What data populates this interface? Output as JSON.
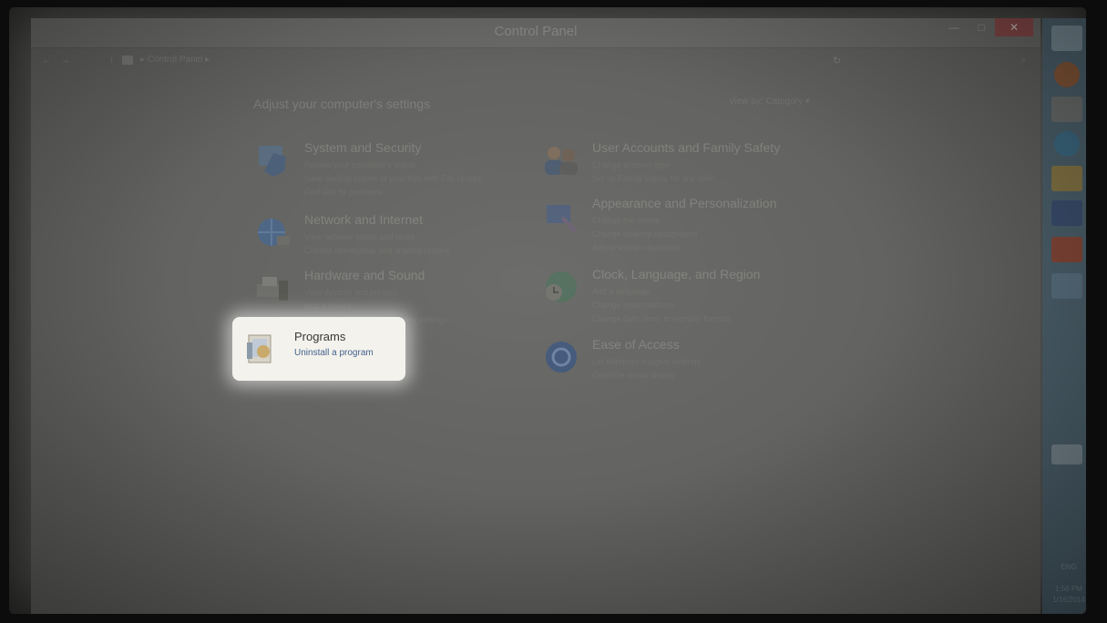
{
  "window": {
    "title": "Control Panel",
    "minimize_glyph": "—",
    "maximize_glyph": "□",
    "close_glyph": "✕"
  },
  "address": {
    "back": "←",
    "forward": "→",
    "up": "↑",
    "breadcrumb": "▸ Control Panel ▸",
    "refresh": "↻",
    "search_icon": "⌕"
  },
  "main": {
    "heading": "Adjust your computer's settings",
    "view_by_label": "View by:",
    "view_by_value": "Category ▾"
  },
  "categories": [
    {
      "name": "system-security",
      "icon": "shield-computer-icon",
      "title": "System and Security",
      "links": [
        "Review your computer's status",
        "Save backup copies of your files with File History",
        "Find and fix problems"
      ]
    },
    {
      "name": "network-internet",
      "icon": "globe-network-icon",
      "title": "Network and Internet",
      "links": [
        "View network status and tasks",
        "Choose homegroup and sharing options"
      ]
    },
    {
      "name": "hardware-sound",
      "icon": "printer-speaker-icon",
      "title": "Hardware and Sound",
      "links": [
        "View devices and printers",
        "Add a device",
        "Adjust commonly used mobility settings"
      ]
    },
    {
      "name": "programs",
      "icon": "programs-box-icon",
      "title": "Programs",
      "links": [
        "Uninstall a program"
      ]
    },
    {
      "name": "user-accounts",
      "icon": "users-icon",
      "title": "User Accounts and Family Safety",
      "links": [
        "Change account type",
        "Set up Family Safety for any user"
      ]
    },
    {
      "name": "appearance",
      "icon": "paintbrush-display-icon",
      "title": "Appearance and Personalization",
      "links": [
        "Change the theme",
        "Change desktop background",
        "Adjust screen resolution"
      ]
    },
    {
      "name": "clock-region",
      "icon": "clock-globe-icon",
      "title": "Clock, Language, and Region",
      "links": [
        "Add a language",
        "Change input methods",
        "Change date, time, or number formats"
      ]
    },
    {
      "name": "ease-of-access",
      "icon": "accessibility-icon",
      "title": "Ease of Access",
      "links": [
        "Let Windows suggest settings",
        "Optimize visual display"
      ]
    }
  ],
  "taskbar": {
    "icons": [
      "windows-start-icon",
      "firefox-icon",
      "store-icon",
      "ie-icon",
      "file-explorer-icon",
      "word-icon",
      "powerpoint-icon",
      "control-panel-icon",
      "keyboard-icon"
    ],
    "language": "ENG",
    "time": "1:56 PM",
    "date": "1/16/2014"
  },
  "colors": {
    "highlight_bg": "#f4f2ec",
    "taskbar": "#4f6470",
    "close_button": "#8a4a4a"
  }
}
